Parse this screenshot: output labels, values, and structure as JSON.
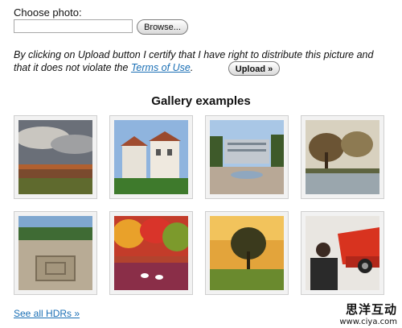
{
  "upload_form": {
    "choose_label": "Choose photo:",
    "browse_label": "Browse...",
    "disclaimer_pre": "By clicking on Upload button I certify that I have right to distribute this picture and that it does not violate the ",
    "terms_link": "Terms of Use",
    "disclaimer_post": ".",
    "upload_label": "Upload »"
  },
  "gallery": {
    "title": "Gallery examples",
    "thumbnails": [
      {
        "subject": "cloudy-field-landscape"
      },
      {
        "subject": "villa-buildings"
      },
      {
        "subject": "plaza-fountain"
      },
      {
        "subject": "trees-by-lake"
      },
      {
        "subject": "stone-ruins"
      },
      {
        "subject": "autumn-lake-swans"
      },
      {
        "subject": "lone-tree-sunset"
      },
      {
        "subject": "man-with-sports-car"
      }
    ],
    "see_all": "See all HDRs »"
  },
  "watermark": {
    "cn": "思洋互动",
    "url": "www.ciya.com"
  },
  "colors": {
    "link": "#1a6fb5",
    "thumb_border": "#cfcfcf"
  }
}
